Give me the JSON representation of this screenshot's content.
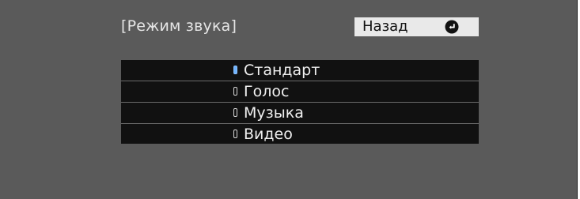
{
  "dialog": {
    "title": "[Режим звука]",
    "back_button": {
      "label": "Назад",
      "icon": "return-icon"
    }
  },
  "options": [
    {
      "label": "Стандарт",
      "selected": true
    },
    {
      "label": "Голос",
      "selected": false
    },
    {
      "label": "Музыка",
      "selected": false
    },
    {
      "label": "Видео",
      "selected": false
    }
  ],
  "colors": {
    "panel_bg": "#5a5a5a",
    "list_bg": "#111111",
    "button_bg": "#e9e9e9",
    "selected_indicator": "#6fb3ff",
    "text": "#f0f0f0"
  }
}
